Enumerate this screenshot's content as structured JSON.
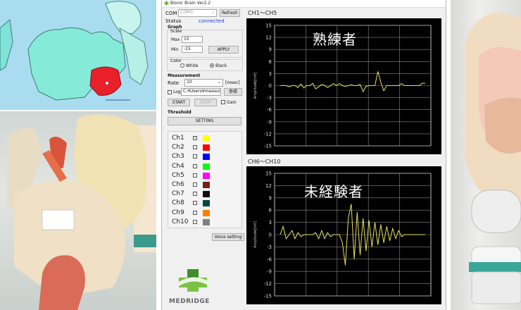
{
  "app": {
    "title": "Bionic Brain  Ver2.2",
    "com_label": "COM",
    "com_value": "COM3",
    "refresh_label": "Refresh",
    "status_label": "Status",
    "status_value": "connected",
    "graph_group": "Graph",
    "scale_group": "Scale",
    "max_label": "Max",
    "max_value": "15",
    "min_label": "Min",
    "min_value": "-15",
    "apply_label": "APPLY",
    "color_group": "Color",
    "color_white": "White",
    "color_black": "Black",
    "measurement_group": "Measurement",
    "rate_label": "Rate",
    "rate_value": "10",
    "rate_unit": "[msec]",
    "log_label": "Log",
    "log_path": "C:¥Users¥measure¥",
    "browse_label": "参照",
    "start_label": "START",
    "stop_label": "STOP",
    "gain_label": "Gain",
    "threshold_group": "Threshold",
    "setting_label": "SETTING",
    "voice_setting_label": "Voice setting",
    "logo_text": "MEDRIDGE"
  },
  "channels": [
    {
      "name": "Ch1",
      "checked": true,
      "color": "#ffff00"
    },
    {
      "name": "Ch2",
      "checked": false,
      "color": "#ff0000"
    },
    {
      "name": "Ch3",
      "checked": false,
      "color": "#0000ff"
    },
    {
      "name": "Ch4",
      "checked": false,
      "color": "#00ff00"
    },
    {
      "name": "Ch5",
      "checked": false,
      "color": "#ff00ff"
    },
    {
      "name": "Ch6",
      "checked": false,
      "color": "#7a1a1a"
    },
    {
      "name": "Ch7",
      "checked": false,
      "color": "#1a0a0a"
    },
    {
      "name": "Ch8",
      "checked": false,
      "color": "#004a40"
    },
    {
      "name": "Ch9",
      "checked": false,
      "color": "#ff8000"
    },
    {
      "name": "Ch10",
      "checked": false,
      "color": "#808080"
    }
  ],
  "graphs": {
    "top_title": "CH1～CH5",
    "top_annotation": "熟練者",
    "bottom_title": "CH6～CH10",
    "bottom_annotation": "未経験者",
    "ylabel": "Amplitude[mV]",
    "line_color": "#e8e060"
  },
  "chart_data": [
    {
      "type": "line",
      "title": "CH1～CH5",
      "ylabel": "Amplitude[mV]",
      "ylim": [
        -15,
        15
      ],
      "yticks": [
        15,
        12,
        9,
        6,
        3,
        0,
        -3,
        -6,
        -9,
        -12,
        -15
      ],
      "grid": true,
      "series": [
        {
          "values": [
            0,
            0,
            0,
            -0.3,
            0,
            0,
            -0.5,
            0.4,
            -0.6,
            0,
            0,
            0.6,
            -0.8,
            -0.3,
            0.3,
            0,
            -0.5,
            0,
            0.5,
            0,
            0.5,
            0,
            -0.2,
            0,
            0.2,
            0,
            0,
            0.3,
            -1.5,
            -0.2,
            0,
            0,
            0,
            3.5,
            0.8,
            -1.3,
            0,
            0,
            0,
            0,
            0,
            0.5,
            0,
            0,
            0,
            0,
            0,
            0,
            0.6,
            0.6
          ]
        }
      ]
    },
    {
      "type": "line",
      "title": "CH6～CH10",
      "ylabel": "Amplitude[mV]",
      "ylim": [
        -15,
        15
      ],
      "yticks": [
        15,
        12,
        9,
        6,
        3,
        0,
        -3,
        -6,
        -9,
        -12,
        -15
      ],
      "grid": true,
      "series": [
        {
          "values": [
            0,
            2,
            -1,
            0,
            1,
            -1,
            0.5,
            -0.5,
            0,
            0,
            0,
            0,
            0.5,
            -1,
            1,
            -1,
            0.5,
            -0.5,
            0,
            0,
            0,
            -2,
            -7.5,
            4,
            7.5,
            -6,
            5.5,
            -5,
            4,
            -4,
            3.5,
            -3,
            3,
            -2.5,
            2.5,
            -2,
            2,
            -1.5,
            1.5,
            -1,
            1,
            -0.5,
            0,
            0,
            0,
            0,
            0,
            0,
            0,
            0
          ]
        }
      ]
    }
  ]
}
